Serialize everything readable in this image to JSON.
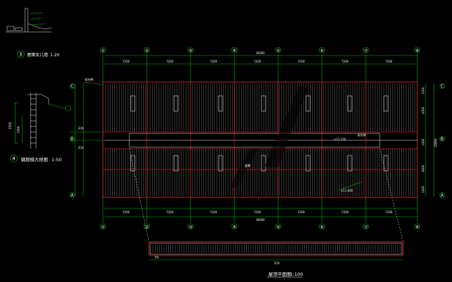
{
  "main_plan": {
    "title": "屋顶平面图",
    "scale": "1:100",
    "column_axes": [
      "①",
      "②",
      "③",
      "④",
      "⑤",
      "⑥",
      "⑦",
      "⑧"
    ],
    "row_axes": [
      "C",
      "B",
      "A"
    ],
    "overall_dim": "36000",
    "bay_dims": [
      "7200",
      "7200",
      "7200",
      "7200",
      "7200",
      "7200",
      "7200"
    ],
    "side_dims": [
      "1200",
      "4500",
      "1300",
      "3600",
      "1200"
    ],
    "total_depth": "10800",
    "notes": {
      "ridge_elev": "±11.370",
      "ridge_label": "屋脊",
      "eave_elev": "±11.000",
      "vent_left": "采光带",
      "vent_right": "采光带",
      "gutter_left": "天沟",
      "gutter_right": "天沟"
    }
  },
  "detail_3": {
    "number": "3",
    "title": "屋面女儿墙",
    "scale": "1:20"
  },
  "detail_4": {
    "number": "4",
    "title": "钢爬梯大样图",
    "scale": "1:50",
    "dims": [
      "2500",
      "1500"
    ]
  },
  "section_strip": {
    "left_label": "1%",
    "mid_label": "天沟"
  },
  "colors": {
    "background": "#000000",
    "grid": "#00c000",
    "structure": "#d01010",
    "outline": "#ffffff",
    "hatch": "#7a7a7a"
  }
}
